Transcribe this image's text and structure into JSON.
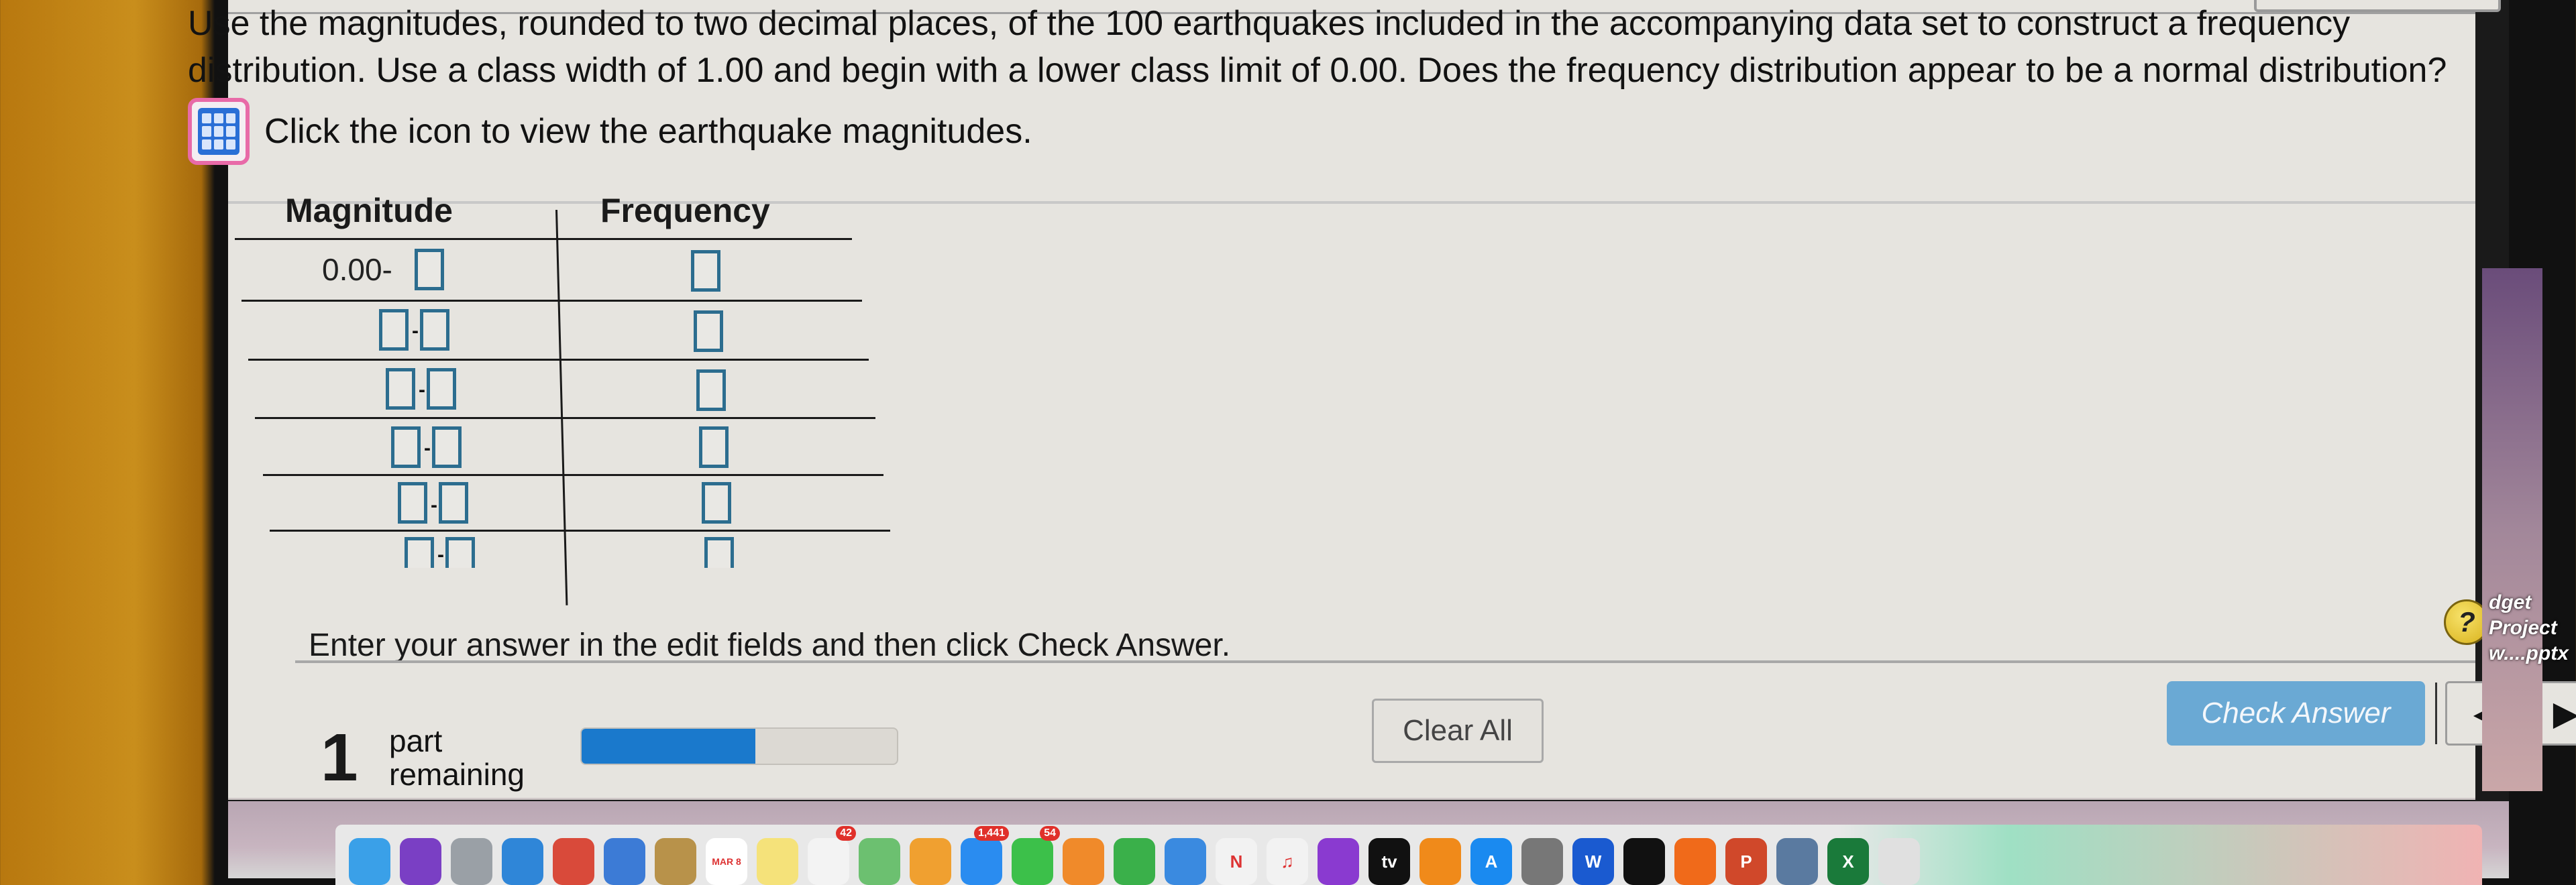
{
  "question": {
    "line1": "Use the magnitudes, rounded to two decimal places, of the 100 earthquakes included in the accompanying data set to construct a frequency",
    "line2": "distribution. Use a class width of 1.00 and begin with a lower class limit of 0.00. Does the frequency distribution appear to be a normal distribution?",
    "data_link_text": "Click the icon to view the earthquake magnitudes.",
    "data_icon": "data-table-icon"
  },
  "table": {
    "headers": {
      "magnitude": "Magnitude",
      "frequency": "Frequency"
    },
    "first_lower_limit": "0.00-",
    "rows": [
      {
        "lower": "0.00",
        "upper": "",
        "frequency": ""
      },
      {
        "lower": "",
        "upper": "",
        "frequency": ""
      },
      {
        "lower": "",
        "upper": "",
        "frequency": ""
      },
      {
        "lower": "",
        "upper": "",
        "frequency": ""
      },
      {
        "lower": "",
        "upper": "",
        "frequency": ""
      },
      {
        "lower": "",
        "upper": "",
        "frequency": ""
      }
    ],
    "dash": "-"
  },
  "instruction": "Enter your answer in the edit fields and then click Check Answer.",
  "help": {
    "label": "?"
  },
  "footer": {
    "parts_count": "1",
    "parts_line1": "part",
    "parts_line2": "remaining",
    "progress_fraction": 0.55,
    "clear_all_label": "Clear All",
    "check_answer_label": "Check Answer",
    "prev_label": "◀",
    "next_label": "▶"
  },
  "desktop": {
    "side_file_line1": "dget Project",
    "side_file_line2": "w....pptx"
  },
  "dock": {
    "items": [
      {
        "name": "finder",
        "color": "#3aa0e8",
        "label": ""
      },
      {
        "name": "siri",
        "color": "#7a3fc4",
        "label": ""
      },
      {
        "name": "launchpad",
        "color": "#9aa0a6",
        "label": ""
      },
      {
        "name": "safari",
        "color": "#2f86d8",
        "label": ""
      },
      {
        "name": "chrome",
        "color": "#d94a3a",
        "label": ""
      },
      {
        "name": "preview",
        "color": "#3c7bd6",
        "label": ""
      },
      {
        "name": "contacts",
        "color": "#b8924a",
        "label": ""
      },
      {
        "name": "calendar",
        "color": "#ffffff",
        "label": "MAR 8"
      },
      {
        "name": "notes",
        "color": "#f5e27a",
        "label": ""
      },
      {
        "name": "reminders",
        "color": "#f3f3f3",
        "label": "",
        "badge": "42"
      },
      {
        "name": "maps",
        "color": "#6cc070",
        "label": ""
      },
      {
        "name": "photos",
        "color": "#f0a030",
        "label": ""
      },
      {
        "name": "messages",
        "color": "#2a8cf0",
        "label": "",
        "badge": "1,441"
      },
      {
        "name": "facetime",
        "color": "#3cc04a",
        "label": "",
        "badge": "54"
      },
      {
        "name": "pages",
        "color": "#f08a2a",
        "label": ""
      },
      {
        "name": "numbers",
        "color": "#3ab04a",
        "label": ""
      },
      {
        "name": "keynote",
        "color": "#3a8ae0",
        "label": ""
      },
      {
        "name": "news",
        "color": "#f2f2f2",
        "label": "N"
      },
      {
        "name": "music",
        "color": "#f2f2f2",
        "label": "♫"
      },
      {
        "name": "podcasts",
        "color": "#8a3ad0",
        "label": ""
      },
      {
        "name": "apple-tv",
        "color": "#111111",
        "label": "tv"
      },
      {
        "name": "books",
        "color": "#f08a1a",
        "label": ""
      },
      {
        "name": "app-store",
        "color": "#1a8af0",
        "label": "A"
      },
      {
        "name": "system-preferences",
        "color": "#777777",
        "label": ""
      },
      {
        "name": "word",
        "color": "#1a5ad0",
        "label": "W"
      },
      {
        "name": "vpn",
        "color": "#111111",
        "label": ""
      },
      {
        "name": "firefox",
        "color": "#f06a1a",
        "label": ""
      },
      {
        "name": "powerpoint",
        "color": "#d0482a",
        "label": "P"
      },
      {
        "name": "image-capture",
        "color": "#5a7aa0",
        "label": ""
      },
      {
        "name": "excel",
        "color": "#1a7a3a",
        "label": "X"
      },
      {
        "name": "trash",
        "color": "#e0e0e0",
        "label": ""
      }
    ]
  }
}
